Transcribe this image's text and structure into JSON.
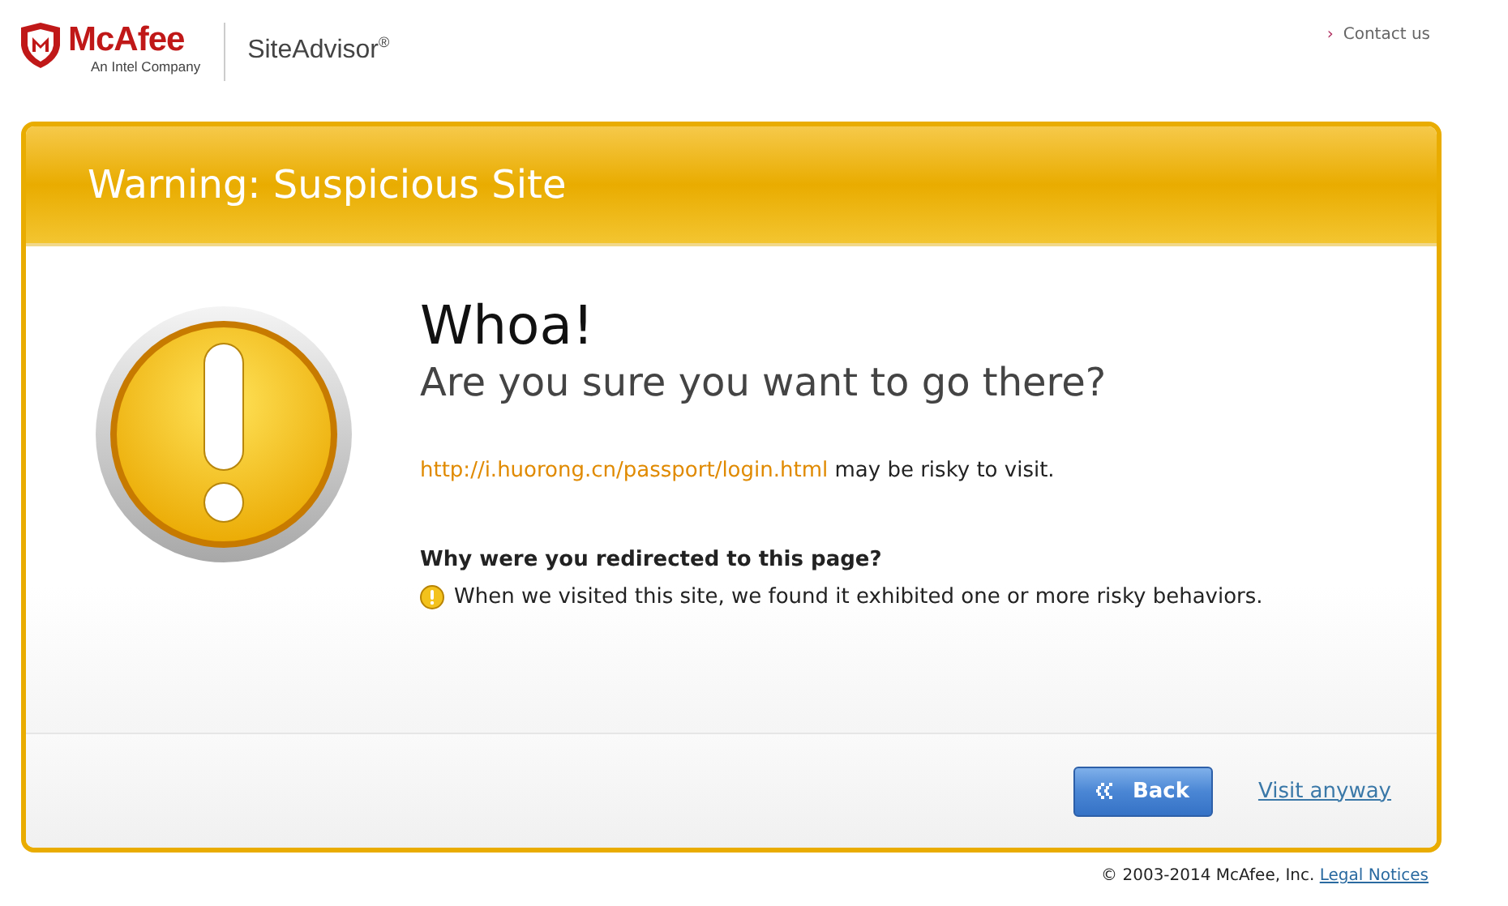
{
  "header": {
    "brand": "McAfee",
    "tagline": "An Intel Company",
    "product": "SiteAdvisor$^{®}$",
    "contact_link": {
      "marker": "›",
      "label": "Contact us"
    }
  },
  "warning": {
    "title": "Warning: Suspicious Site",
    "heading": "Whoa!",
    "subheading": "Are you sure you want to go there?",
    "url": "http://i.huorong.cn/passport/login.html",
    "risk_text": "may be risky to visit.",
    "reason_title": "Why were you redirected to this page?",
    "reasons": [
      {
        "kind": "warning",
        "text": "When we visited this site, we found it exhibited one or more risky behaviors."
      }
    ],
    "buttons": {
      "back": "Back",
      "visit": "Visit anyway"
    }
  },
  "footer": {
    "copyright": "© 2003-2014 McAfee, Inc.",
    "legal_link": "Legal Notices"
  }
}
